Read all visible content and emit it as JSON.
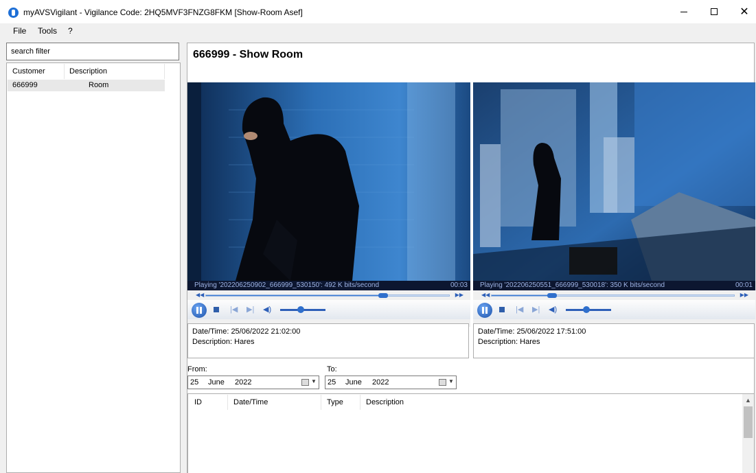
{
  "window": {
    "title": "myAVSVigilant - Vigilance Code: 2HQ5MVF3FNZG8FKM [Show-Room Asef]",
    "minimize": "–",
    "close": "✕"
  },
  "menu": {
    "file": "File",
    "tools": "Tools",
    "help": "?"
  },
  "search": {
    "value": "search filter"
  },
  "customers": {
    "columns": [
      "Customer Code",
      "Description"
    ],
    "rows": [
      {
        "code": "666999",
        "description": "Room"
      }
    ]
  },
  "main": {
    "title": "666999 - Show Room"
  },
  "cameras": [
    {
      "status": "Playing '202206250902_666999_530150': 492 K bits/second",
      "elapsed": "00:03",
      "progress": 0.73,
      "volume": 0.45,
      "datetime": "Date/Time: 25/06/2022 21:02:00",
      "description": "Description: Hares"
    },
    {
      "status": "Playing '202206250551_666999_530018': 350 K bits/second",
      "elapsed": "00:01",
      "progress": 0.25,
      "volume": 0.45,
      "datetime": "Date/Time: 25/06/2022 17:51:00",
      "description": "Description: Hares"
    }
  ],
  "filter": {
    "from_label": "From:",
    "to_label": "To:",
    "from": {
      "day": "25",
      "month": "June",
      "year": "2022"
    },
    "to": {
      "day": "25",
      "month": "June",
      "year": "2022"
    }
  },
  "events": {
    "columns": [
      "ID",
      "Date/Time",
      "Type",
      "Description"
    ]
  },
  "colors": {
    "accent": "#2f6fcc",
    "statusbar": "#0c1630"
  },
  "icons": {
    "play_pause": "pause-icon",
    "stop": "stop-icon",
    "prev": "previous-icon",
    "next": "next-icon",
    "volume": "volume-icon",
    "rewind": "rewind-icon",
    "fast_forward": "fast-forward-icon",
    "calendar": "calendar-icon"
  }
}
